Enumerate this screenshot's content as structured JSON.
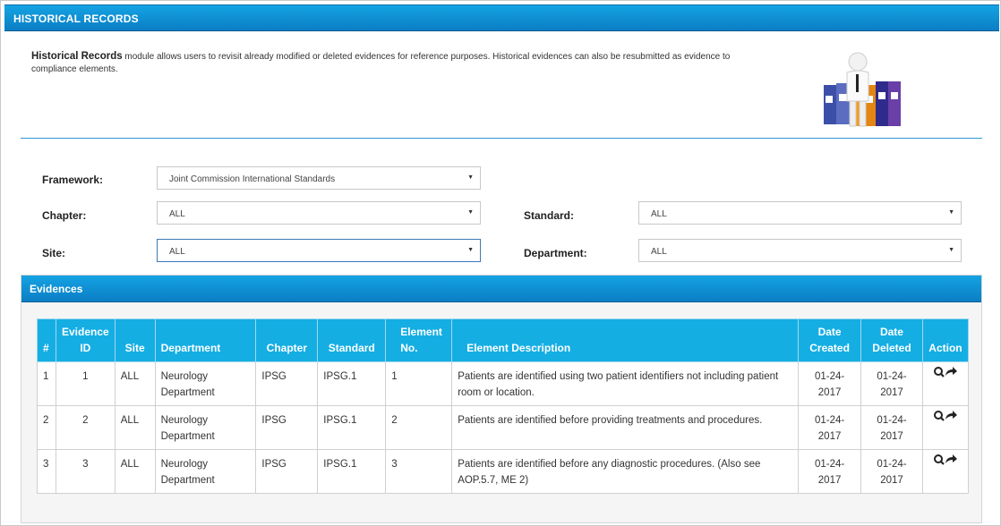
{
  "header": {
    "title": "HISTORICAL RECORDS"
  },
  "intro": {
    "bold": "Historical Records",
    "text": " module allows users to revisit already modified or deleted evidences for reference purposes. Historical evidences can also be resubmitted as evidence to compliance elements."
  },
  "filters": {
    "framework": {
      "label": "Framework:",
      "value": "Joint Commission International Standards"
    },
    "chapter": {
      "label": "Chapter:",
      "value": "ALL"
    },
    "standard": {
      "label": "Standard:",
      "value": "ALL"
    },
    "site": {
      "label": "Site:",
      "value": "ALL"
    },
    "department": {
      "label": "Department:",
      "value": "ALL"
    }
  },
  "evidences": {
    "title": "Evidences",
    "columns": {
      "num": "#",
      "evidence_id_1": "Evidence",
      "evidence_id_2": "ID",
      "site": "Site",
      "department": "Department",
      "chapter": "Chapter",
      "standard": "Standard",
      "element_no_1": "Element",
      "element_no_2": "No.",
      "element_description": "Element Description",
      "date_created_1": "Date",
      "date_created_2": "Created",
      "date_deleted_1": "Date",
      "date_deleted_2": "Deleted",
      "action": "Action"
    },
    "rows": [
      {
        "num": "1",
        "evidence_id": "1",
        "site": "ALL",
        "department": "Neurology Department",
        "chapter": "IPSG",
        "standard": "IPSG.1",
        "element_no": "1",
        "description": "Patients are identified using two patient identifiers not including patient room or location.",
        "date_created": "01-24-2017",
        "date_deleted": "01-24-2017"
      },
      {
        "num": "2",
        "evidence_id": "2",
        "site": "ALL",
        "department": "Neurology Department",
        "chapter": "IPSG",
        "standard": "IPSG.1",
        "element_no": "2",
        "description": "Patients are identified before providing treatments and procedures.",
        "date_created": "01-24-2017",
        "date_deleted": "01-24-2017"
      },
      {
        "num": "3",
        "evidence_id": "3",
        "site": "ALL",
        "department": "Neurology Department",
        "chapter": "IPSG",
        "standard": "IPSG.1",
        "element_no": "3",
        "description": "Patients are identified before any diagnostic procedures. (Also see AOP.5.7, ME 2)",
        "date_created": "01-24-2017",
        "date_deleted": "01-24-2017"
      }
    ],
    "action_icons": [
      "view-icon",
      "resubmit-arrow-icon"
    ]
  },
  "colors": {
    "header_blue": "#0b7ec4",
    "table_header": "#15aee3"
  }
}
